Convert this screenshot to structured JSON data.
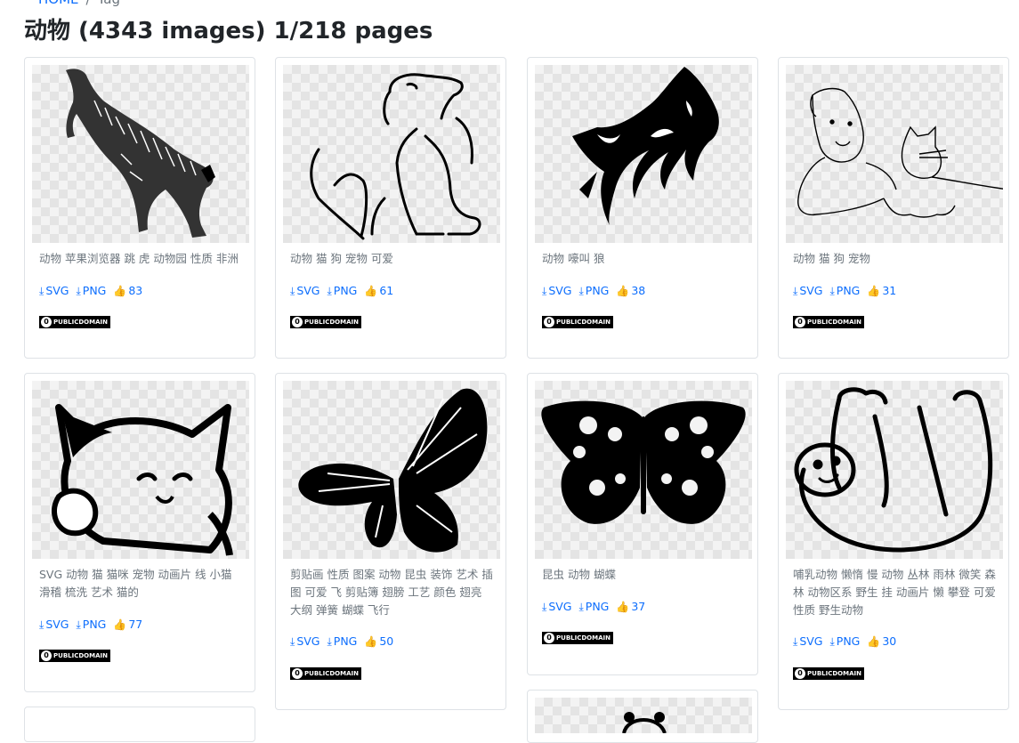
{
  "breadcrumb": {
    "home": "HOME",
    "separator": "/",
    "current": "Tag"
  },
  "page": {
    "title": "动物 (4343 images) 1/218 pages"
  },
  "cards": [
    {
      "tags": "动物 苹果浏览器 跳 虎 动物园 性质 非洲",
      "svg": "SVG",
      "png": "PNG",
      "likes": "83",
      "license": "PUBLICDOMAIN",
      "image": "tiger-icon"
    },
    {
      "tags": "动物 猫 狗 宠物 可爱",
      "svg": "SVG",
      "png": "PNG",
      "likes": "61",
      "license": "PUBLICDOMAIN",
      "image": "dog-cat-outline-icon"
    },
    {
      "tags": "动物 嚎叫 狼",
      "svg": "SVG",
      "png": "PNG",
      "likes": "38",
      "license": "PUBLICDOMAIN",
      "image": "howling-wolf-icon"
    },
    {
      "tags": "动物 猫 狗 宠物",
      "svg": "SVG",
      "png": "PNG",
      "likes": "31",
      "license": "PUBLICDOMAIN",
      "image": "dog-and-cat-icon"
    },
    {
      "tags": "SVG 动物 猫 猫咪 宠物 动画片 线 小猫 滑稽 梳洗 艺术 猫的",
      "svg": "SVG",
      "png": "PNG",
      "likes": "77",
      "license": "PUBLICDOMAIN",
      "image": "lucky-cat-icon"
    },
    {
      "tags": "剪贴画 性质 图案 动物 昆虫 装饰 艺术 插图 可爱 飞 剪贴簿 翅膀 工艺 颜色 翅亮 大纲 弹簧 蝴蝶 飞行",
      "svg": "SVG",
      "png": "PNG",
      "likes": "50",
      "license": "PUBLICDOMAIN",
      "image": "butterfly-icon"
    },
    {
      "tags": "昆虫 动物 蝴蝶",
      "svg": "SVG",
      "png": "PNG",
      "likes": "37",
      "license": "PUBLICDOMAIN",
      "image": "ornate-butterfly-icon"
    },
    {
      "tags": "哺乳动物 懒惰 慢 动物 丛林 雨林 微笑 森林 动物区系 野生 挂 动画片 懒 攀登 可爱 性质 野生动物",
      "svg": "SVG",
      "png": "PNG",
      "likes": "30",
      "license": "PUBLICDOMAIN",
      "image": "sloth-icon"
    }
  ],
  "icons": {
    "download": "download-icon",
    "like": "thumbs-up-icon"
  },
  "colors": {
    "link": "#0d6efd",
    "muted": "#6c757d",
    "border": "#dee2e6"
  }
}
